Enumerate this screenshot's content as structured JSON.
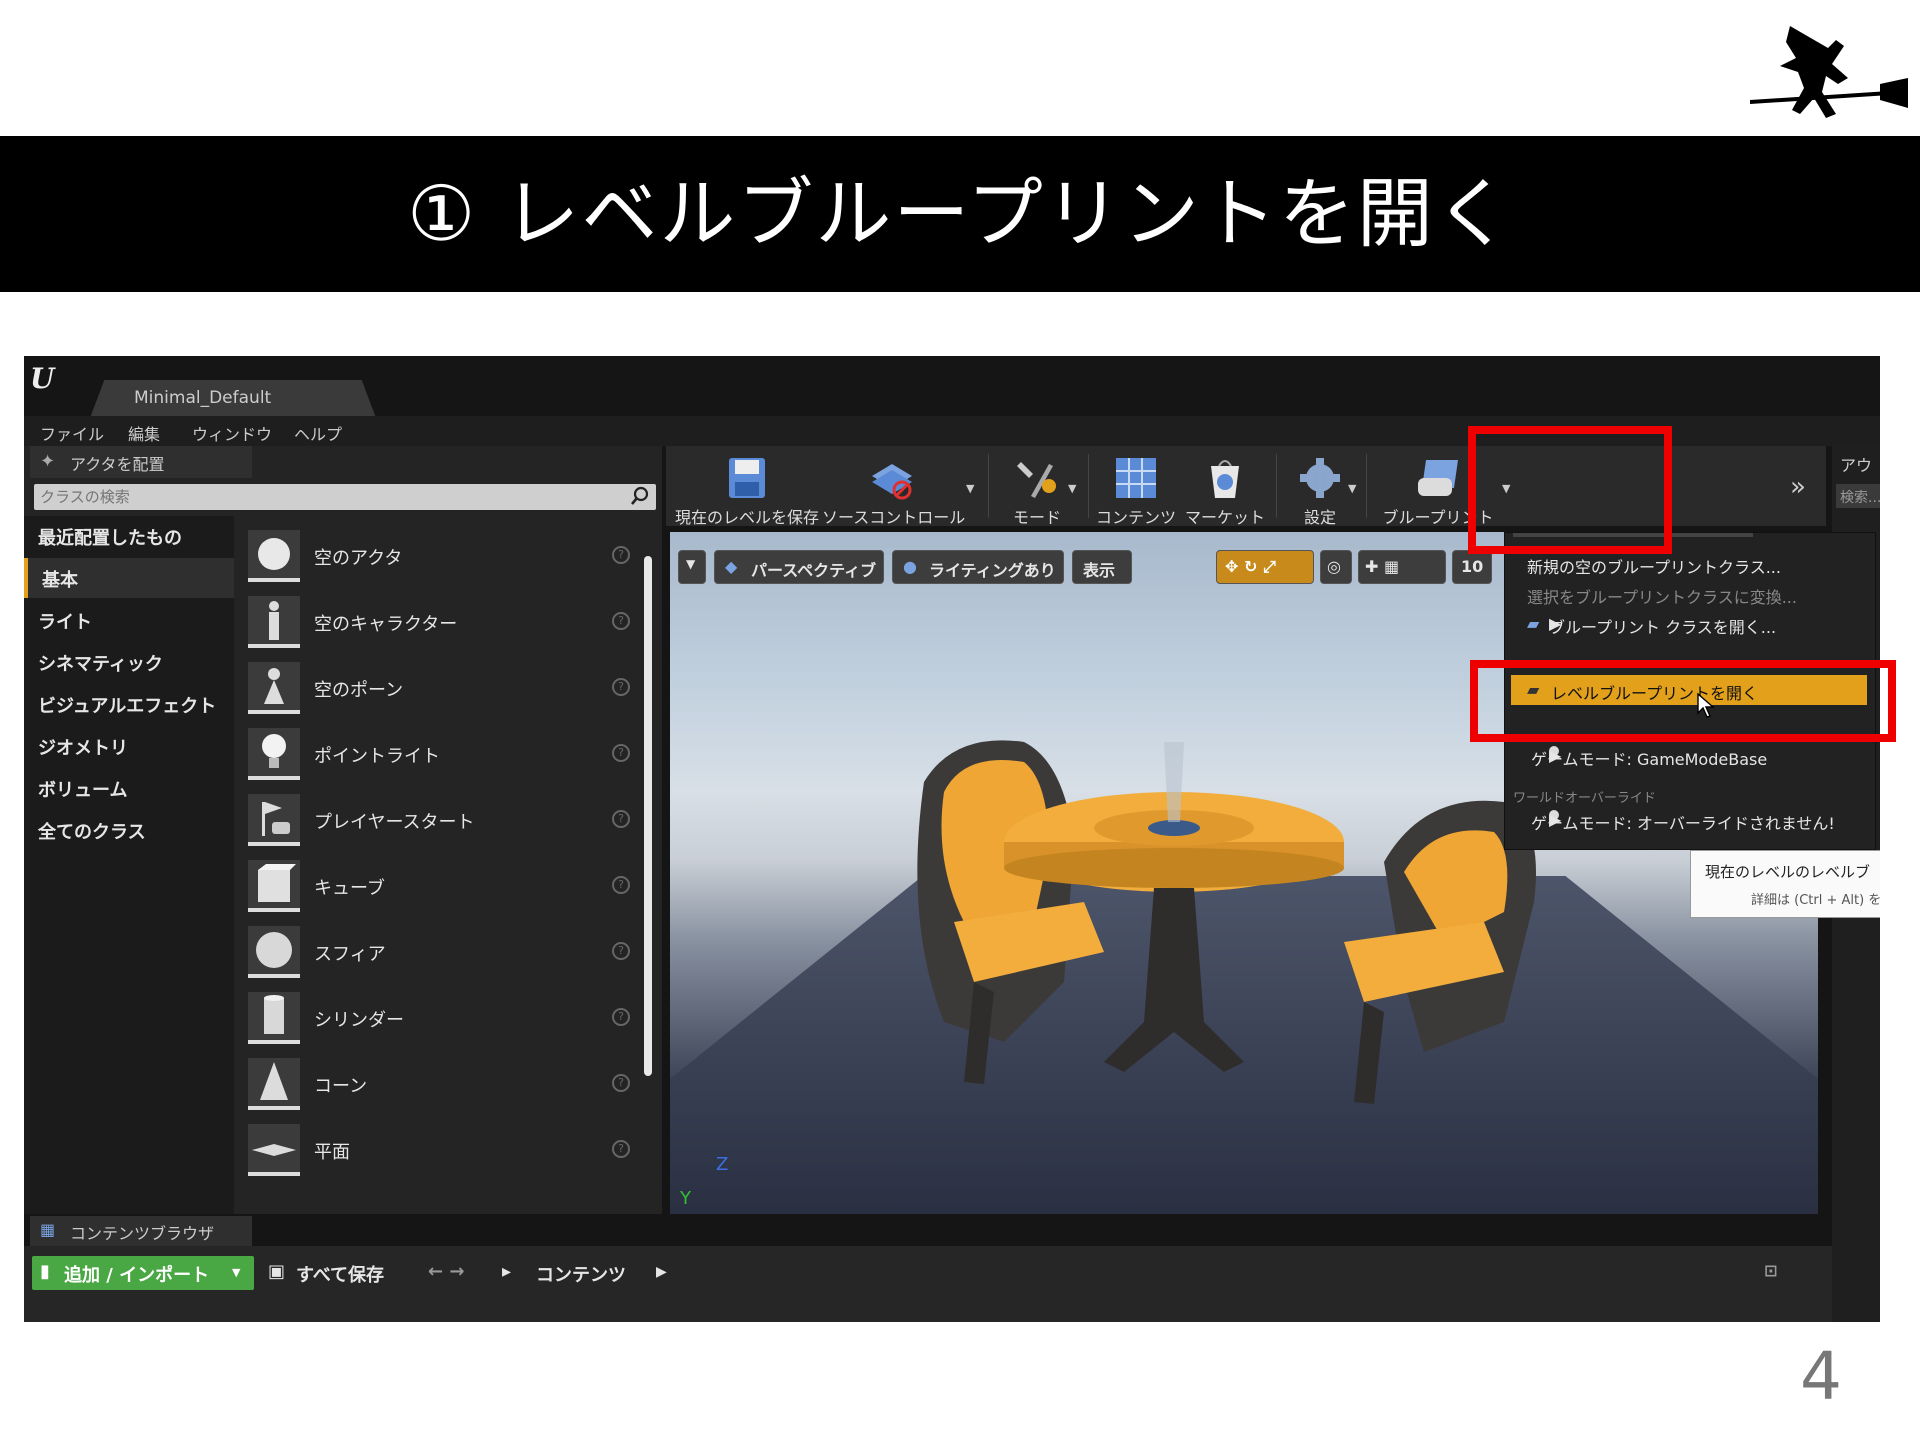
{
  "slide": {
    "title": "① レベルブループリントを開く",
    "page_number": "4"
  },
  "editor": {
    "window_tab": "Minimal_Default",
    "menu": [
      "ファイル",
      "編集",
      "ウィンドウ",
      "ヘルプ"
    ],
    "place_actors": {
      "tab_label": "アクタを配置",
      "search_placeholder": "クラスの検索",
      "categories": [
        "最近配置したもの",
        "基本",
        "ライト",
        "シネマティック",
        "ビジュアルエフェクト",
        "ジオメトリ",
        "ボリューム",
        "全てのクラス"
      ],
      "active_category": "基本",
      "items": [
        "空のアクタ",
        "空のキャラクター",
        "空のポーン",
        "ポイントライト",
        "プレイヤースタート",
        "キューブ",
        "スフィア",
        "シリンダー",
        "コーン",
        "平面"
      ]
    },
    "toolbar": {
      "save_level": "現在のレベルを保存",
      "source_control": "ソースコントロール",
      "modes": "モード",
      "content": "コンテンツ",
      "marketplace": "マーケット",
      "settings": "設定",
      "blueprints": "ブループリント"
    },
    "viewport": {
      "perspective": "パースペクティブ",
      "lighting": "ライティングあり",
      "show": "表示",
      "grid_snap": "10",
      "axis_z": "Z",
      "axis_y": "Y"
    },
    "blueprint_menu": {
      "new_empty": "新規の空のブループリントクラス...",
      "convert_selection": "選択をブループリントクラスに変換...",
      "open_class": "ブループリント クラスを開く...",
      "open_level_blueprint": "レベルブループリントを開く",
      "game_mode": "ゲームモード: GameModeBase",
      "world_override_header": "ワールドオーバーライド",
      "game_mode_override": "ゲームモード: オーバーライドされません!"
    },
    "tooltip": {
      "line1": "現在のレベルのレベルブ",
      "line2": "詳細は (Ctrl + Alt) を"
    },
    "right_panel": {
      "tab_label": "アウ",
      "search_placeholder": "検索..."
    },
    "content_browser": {
      "tab_label": "コンテンツブラウザ",
      "add_import": "追加 / インポート",
      "save_all": "すべて保存",
      "path": "コンテンツ"
    },
    "colors": {
      "accent": "#e3a01b",
      "highlight_box": "#ee0000",
      "add_button": "#4aa844"
    }
  }
}
